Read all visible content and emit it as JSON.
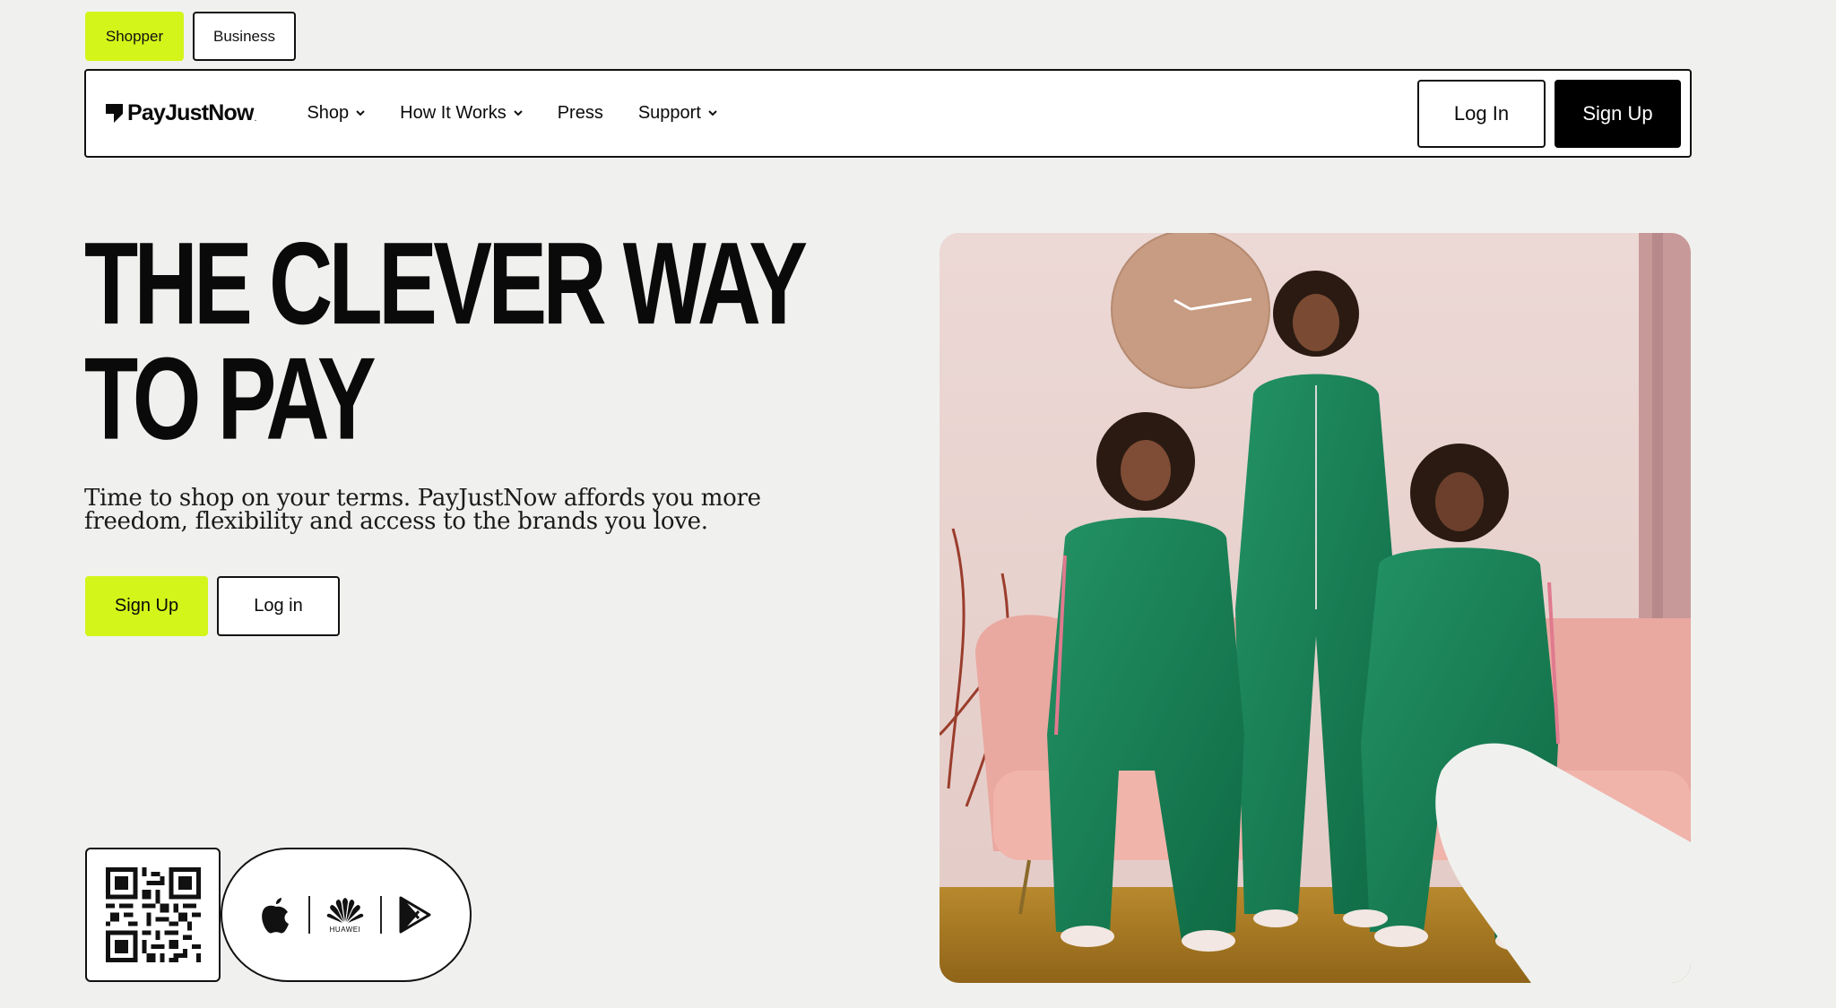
{
  "audience_switch": {
    "shopper": "Shopper",
    "business": "Business"
  },
  "navbar": {
    "logo_text": "PayJustNow",
    "logo_dot": ".",
    "items": [
      {
        "label": "Shop",
        "has_dropdown": true
      },
      {
        "label": "How It Works",
        "has_dropdown": true
      },
      {
        "label": "Press",
        "has_dropdown": false
      },
      {
        "label": "Support",
        "has_dropdown": true
      }
    ],
    "login_label": "Log In",
    "signup_label": "Sign Up"
  },
  "hero": {
    "headline_line1": "THE CLEVER WAY",
    "headline_line2": "TO PAY",
    "subtitle": "Time to shop on your terms. PayJustNow affords you more freedom, flexibility and access to the brands you love.",
    "signup_label": "Sign Up",
    "login_label": "Log in"
  },
  "app_download": {
    "icons": [
      "qr-code-icon",
      "apple-icon",
      "huawei-icon",
      "google-play-icon"
    ],
    "huawei_label": "HUAWEI"
  },
  "colors": {
    "accent": "#d4f51a",
    "background": "#f0f1ef",
    "dark": "#000000"
  }
}
